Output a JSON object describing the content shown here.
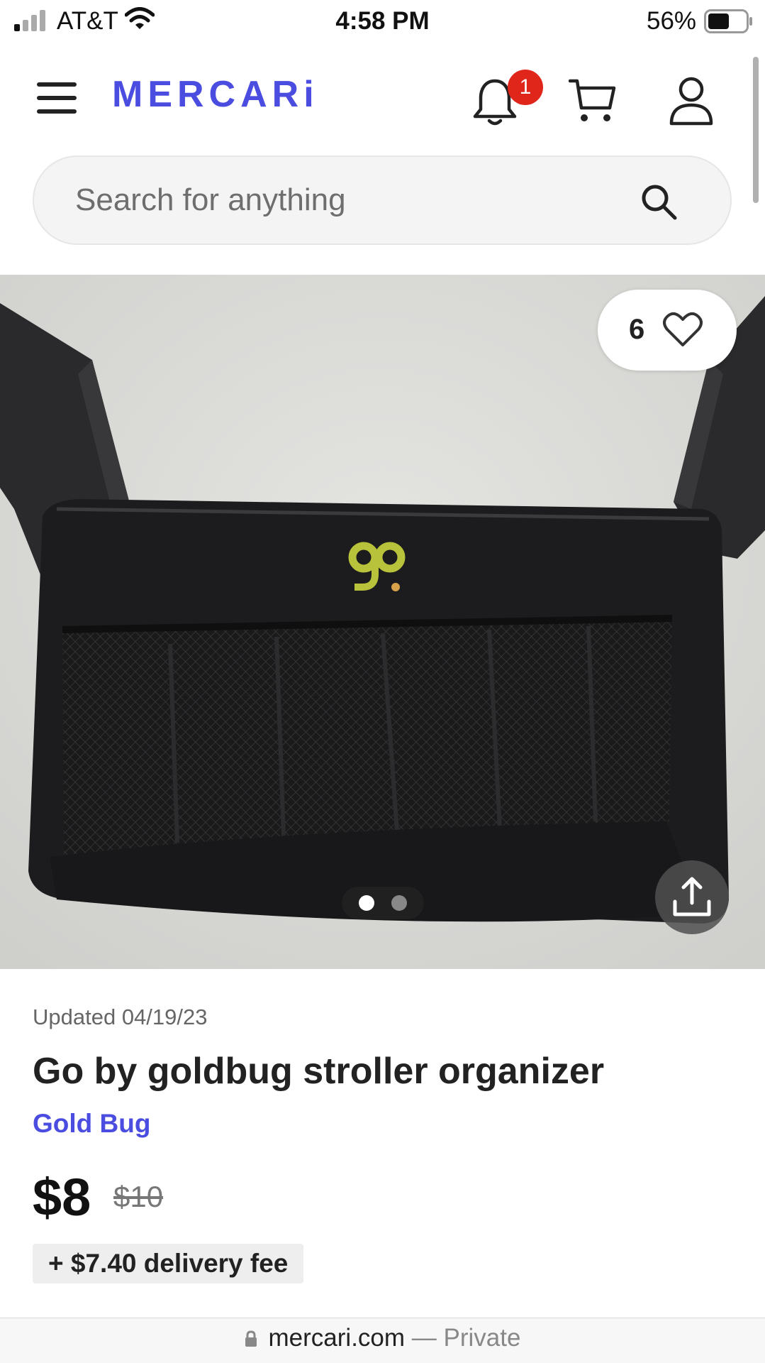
{
  "status_bar": {
    "carrier": "AT&T",
    "time": "4:58 PM",
    "battery_percent": "56%",
    "battery_level": 0.56,
    "icons": [
      "signal-icon",
      "wifi-icon",
      "battery-icon"
    ]
  },
  "header": {
    "logo": "MERCARi",
    "notification_count": "1",
    "icons": [
      "menu-icon",
      "bell-icon",
      "cart-icon",
      "user-icon"
    ]
  },
  "search": {
    "placeholder": "Search for anything",
    "icon": "search-icon"
  },
  "product": {
    "like_count": "6",
    "image_count": 2,
    "current_image": 1,
    "updated": "Updated 04/19/23",
    "title": "Go by goldbug stroller organizer",
    "brand": "Gold Bug",
    "price": "$8",
    "original_price": "$10",
    "delivery_fee": "+ $7.40 delivery fee",
    "icons": [
      "heart-icon",
      "share-icon"
    ]
  },
  "browser": {
    "domain": "mercari.com",
    "separator": "—",
    "mode": "Private",
    "icon": "lock-icon"
  },
  "colors": {
    "brand": "#4a4de0",
    "badge": "#e0251b",
    "text": "#222222",
    "muted": "#666666"
  }
}
